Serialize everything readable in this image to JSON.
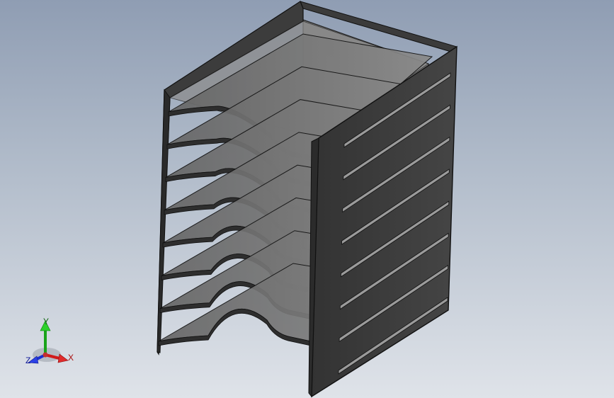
{
  "viewport": {
    "background_top": "#8f9db3",
    "background_bottom": "#dfe3e9"
  },
  "model": {
    "name": "stacked-letter-tray",
    "shelf_count": 8,
    "side_slot_count": 8,
    "panel_color": "#3a3a3a",
    "panel_edge_color": "#111111",
    "shelf_color": "#7a7a7a"
  },
  "triad": {
    "x_label": "X",
    "y_label": "Y",
    "z_label": "Z",
    "x_color": "#d11a1a",
    "y_color": "#1aa31a",
    "z_color": "#1a2fd1"
  }
}
